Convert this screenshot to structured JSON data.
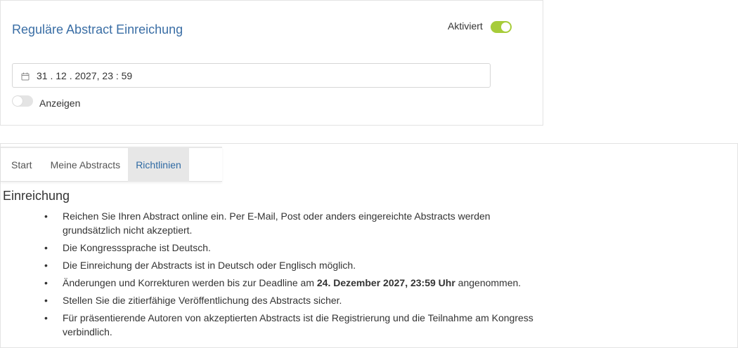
{
  "card": {
    "title": "Reguläre Abstract Einreichung",
    "activated_label": "Aktiviert",
    "activated_on": true,
    "deadline_value": "31 . 12 . 2027, 23 : 59",
    "show_label": "Anzeigen",
    "show_on": false
  },
  "tabs": [
    {
      "label": "Start",
      "active": false
    },
    {
      "label": "Meine Abstracts",
      "active": false
    },
    {
      "label": "Richtlinien",
      "active": true
    }
  ],
  "section": {
    "title": "Einreichung",
    "rules": [
      {
        "text": "Reichen Sie Ihren Abstract online ein. Per E-Mail, Post oder anders eingereichte Abstracts werden grundsätzlich nicht akzeptiert."
      },
      {
        "text": "Die Kongresssprache ist Deutsch."
      },
      {
        "text": "Die Einreichung der Abstracts ist in Deutsch oder Englisch möglich."
      },
      {
        "pre": "Änderungen und Korrekturen werden bis zur Deadline am ",
        "bold": "24. Dezember 2027, 23:59 Uhr",
        "post": " angenommen."
      },
      {
        "text": "Stellen Sie die zitierfähige Veröffentlichung des Abstracts sicher."
      },
      {
        "text": "Für präsentierende Autoren von akzeptierten Abstracts ist die Registrierung und die Teilnahme am Kongress verbindlich."
      }
    ]
  },
  "colors": {
    "title_blue": "#3a6ea5",
    "tab_active_text": "#2f6aa3",
    "toggle_on": "#a7cc3a",
    "toggle_off": "#e4e4e4"
  }
}
